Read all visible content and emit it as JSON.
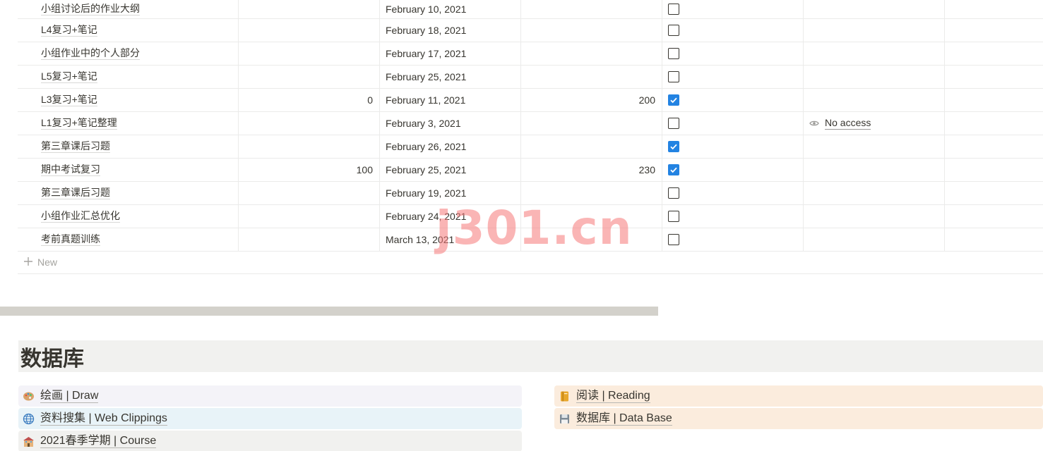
{
  "table": {
    "rows": [
      {
        "name": "小组讨论后的作业大纲",
        "num1": "",
        "date": "February 10, 2021",
        "num2": "",
        "checked": false,
        "access": ""
      },
      {
        "name": "L4复习+笔记",
        "num1": "",
        "date": "February 18, 2021",
        "num2": "",
        "checked": false,
        "access": ""
      },
      {
        "name": "小组作业中的个人部分",
        "num1": "",
        "date": "February 17, 2021",
        "num2": "",
        "checked": false,
        "access": ""
      },
      {
        "name": "L5复习+笔记",
        "num1": "",
        "date": "February 25, 2021",
        "num2": "",
        "checked": false,
        "access": ""
      },
      {
        "name": "L3复习+笔记",
        "num1": "0",
        "date": "February 11, 2021",
        "num2": "200",
        "checked": true,
        "access": ""
      },
      {
        "name": "L1复习+笔记整理",
        "num1": "",
        "date": "February 3, 2021",
        "num2": "",
        "checked": false,
        "access": "No access"
      },
      {
        "name": "第三章课后习题",
        "num1": "",
        "date": "February 26, 2021",
        "num2": "",
        "checked": true,
        "access": ""
      },
      {
        "name": "期中考试复习",
        "num1": "100",
        "date": "February 25, 2021",
        "num2": "230",
        "checked": true,
        "access": ""
      },
      {
        "name": "第三章课后习题",
        "num1": "",
        "date": "February 19, 2021",
        "num2": "",
        "checked": false,
        "access": ""
      },
      {
        "name": "小组作业汇总优化",
        "num1": "",
        "date": "February 24, 2021",
        "num2": "",
        "checked": false,
        "access": ""
      },
      {
        "name": "考前真题训练",
        "num1": "",
        "date": "March 13, 2021",
        "num2": "",
        "checked": false,
        "access": ""
      }
    ],
    "new_label": "New"
  },
  "section": {
    "heading": "数据库"
  },
  "links": {
    "draw": {
      "label": "绘画 | Draw",
      "icon": "palette-icon"
    },
    "web": {
      "label": "资料搜集 | Web Clippings",
      "icon": "globe-icon"
    },
    "course": {
      "label": "2021春季学期 | Course",
      "icon": "school-icon"
    },
    "reading": {
      "label": "阅读 | Reading",
      "icon": "notebook-icon"
    },
    "database": {
      "label": "数据库 | Data Base",
      "icon": "floppy-icon"
    }
  },
  "watermark": "j301.cn",
  "colors": {
    "checkbox_checked": "#2383e2",
    "heading_bg": "#f1f1ef",
    "reading_bg": "#fbecdd",
    "web_bg": "#e8f3f8"
  }
}
